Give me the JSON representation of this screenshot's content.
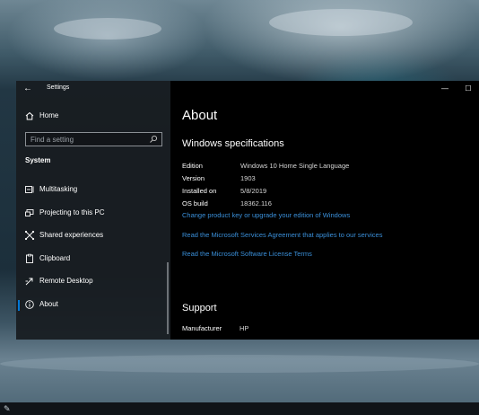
{
  "window": {
    "title": "Settings",
    "controls": {
      "minimize": "—",
      "maximize": "☐"
    }
  },
  "sidebar": {
    "home_label": "Home",
    "search_placeholder": "Find a setting",
    "section_label": "System",
    "items": [
      {
        "label": "Multitasking",
        "icon": "multitasking-icon"
      },
      {
        "label": "Projecting to this PC",
        "icon": "projecting-icon"
      },
      {
        "label": "Shared experiences",
        "icon": "shared-experiences-icon"
      },
      {
        "label": "Clipboard",
        "icon": "clipboard-icon"
      },
      {
        "label": "Remote Desktop",
        "icon": "remote-desktop-icon"
      },
      {
        "label": "About",
        "icon": "info-icon",
        "active": true
      }
    ]
  },
  "content": {
    "page_title": "About",
    "specs_heading": "Windows specifications",
    "specs": [
      {
        "key": "Edition",
        "value": "Windows 10 Home Single Language"
      },
      {
        "key": "Version",
        "value": "1903"
      },
      {
        "key": "Installed on",
        "value": "5/8/2019"
      },
      {
        "key": "OS build",
        "value": "18362.116"
      }
    ],
    "links": [
      "Change product key or upgrade your edition of Windows",
      "Read the Microsoft Services Agreement that applies to our services",
      "Read the Microsoft Software License Terms"
    ],
    "support_heading": "Support",
    "support": [
      {
        "key": "Manufacturer",
        "value": "HP"
      }
    ]
  },
  "colors": {
    "accent": "#0078d7",
    "link": "#3a8fd9",
    "content_bg": "#000000",
    "sidebar_bg": "#181c20"
  }
}
